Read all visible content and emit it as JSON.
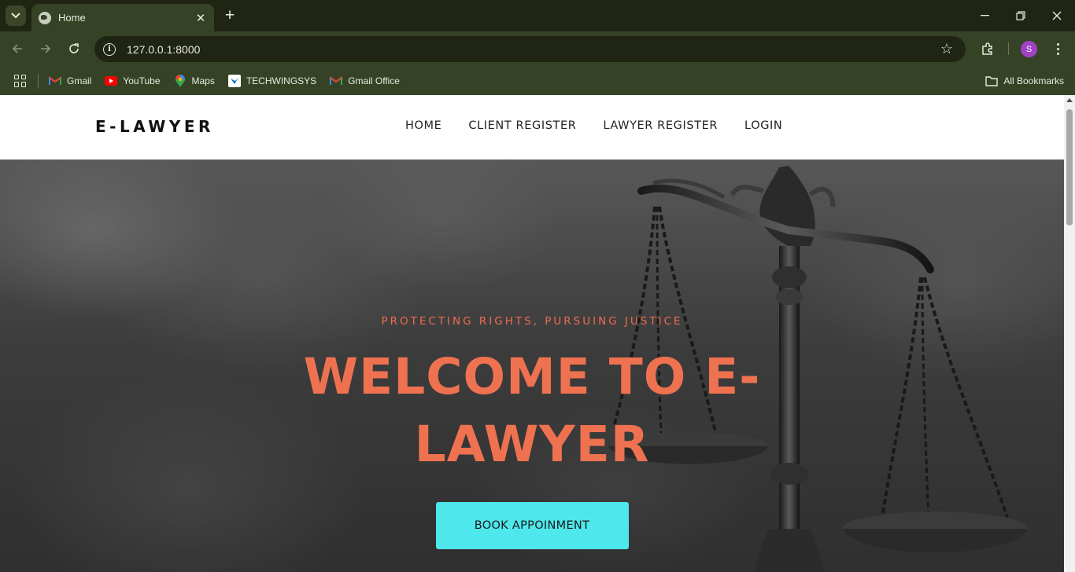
{
  "browser": {
    "tab": {
      "title": "Home",
      "favicon": "globe-icon"
    },
    "address": {
      "url": "127.0.0.1:8000"
    },
    "profile_initial": "S",
    "bookmarks": [
      {
        "label": "Gmail",
        "icon": "gmail-icon"
      },
      {
        "label": "YouTube",
        "icon": "youtube-icon"
      },
      {
        "label": "Maps",
        "icon": "maps-icon"
      },
      {
        "label": "TECHWINGSYS",
        "icon": "techwingsys-icon"
      },
      {
        "label": "Gmail Office",
        "icon": "gmail-icon"
      }
    ],
    "all_bookmarks_label": "All Bookmarks",
    "colors": {
      "frame": "#1f2512",
      "toolbar": "#364226"
    }
  },
  "site": {
    "brand": "E-LAWYER",
    "nav": [
      "HOME",
      "CLIENT REGISTER",
      "LAWYER REGISTER",
      "LOGIN"
    ],
    "hero": {
      "tagline": "PROTECTING RIGHTS, PURSUING JUSTICE",
      "headline": "WELCOME TO E-LAWYER",
      "cta": "BOOK APPOINMENT",
      "background": "scales-of-justice-photo"
    },
    "colors": {
      "accent": "#ef7250",
      "cta": "#4ee7ec"
    }
  }
}
